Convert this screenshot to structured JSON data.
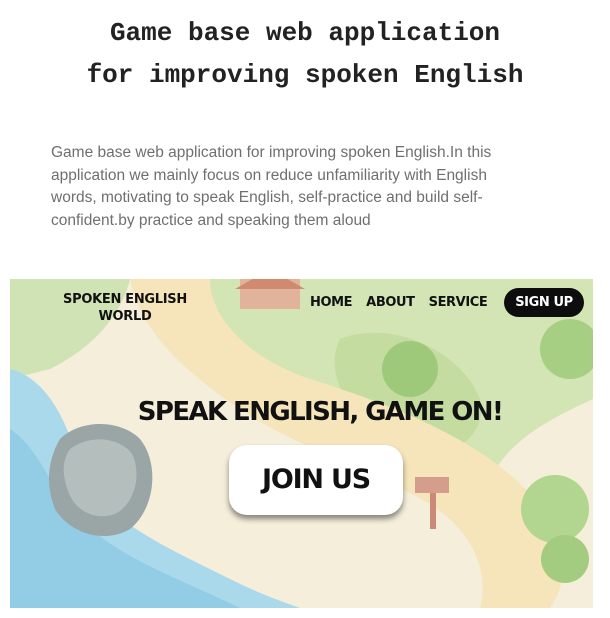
{
  "header": {
    "title_line1": "Game base web application",
    "title_line2": "for improving spoken English"
  },
  "description": "Game base web application for improving spoken English.In this application we mainly focus on reduce unfamiliarity with English words, motivating to speak English, self-practice and build self-confident.by practice and speaking them aloud",
  "preview": {
    "brand_line1": "SPOKEN ENGLISH",
    "brand_line2": "WORLD",
    "nav": {
      "home": "HOME",
      "about": "ABOUT",
      "service": "SERVICE"
    },
    "signup_label": "SIGN UP",
    "tagline": "SPEAK ENGLISH, GAME ON!",
    "join_label": "JOIN US",
    "colors": {
      "signup_bg": "#0d0d0d",
      "water": "#a9d8ea",
      "grass": "#cfe2b0",
      "path": "#f3e2b6"
    }
  }
}
